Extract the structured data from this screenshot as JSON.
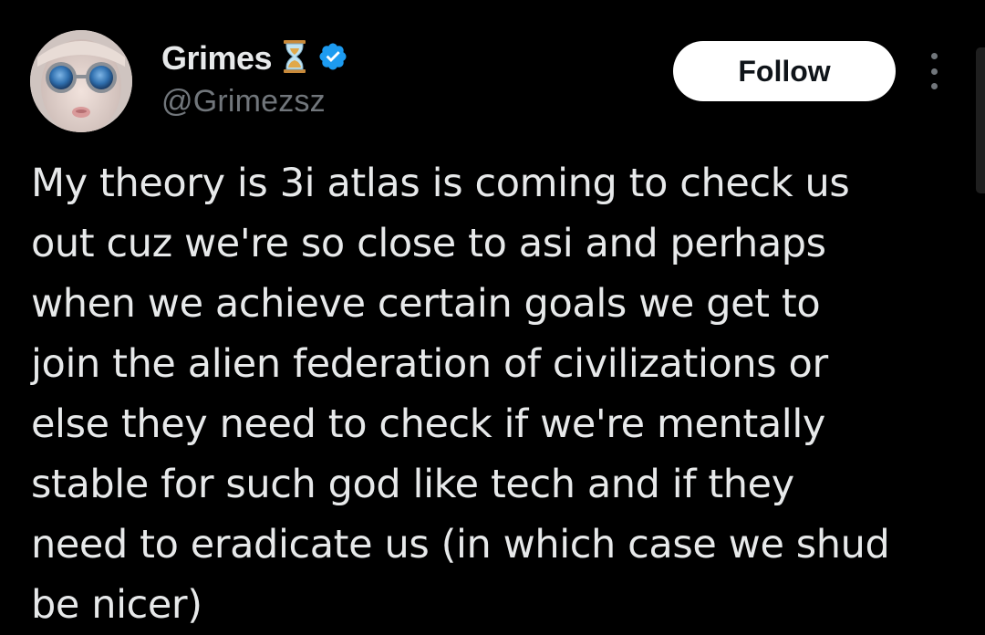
{
  "author": {
    "display_name": "Grimes",
    "emoji": "⏳",
    "verified_icon": "verified-badge-icon",
    "handle": "@Grimezsz",
    "avatar": "avatar-photo"
  },
  "actions": {
    "follow_label": "Follow",
    "more_icon": "more-options-icon"
  },
  "tweet": {
    "text_lines": [
      "My theory is 3i atlas is coming to check us",
      "out cuz we're so close to asi and perhaps",
      "when we achieve certain goals we get to",
      "join the alien federation of civilizations or",
      "else they need to check if we're mentally",
      "stable for such god like tech and if they",
      "need to eradicate us (in which case we shud",
      "be nicer)"
    ]
  },
  "colors": {
    "background": "#000000",
    "primary_text": "#e7e9ea",
    "secondary_text": "#71767b",
    "verified_blue": "#1d9bf0",
    "follow_button_bg": "#ffffff",
    "follow_button_text": "#0f1419"
  }
}
